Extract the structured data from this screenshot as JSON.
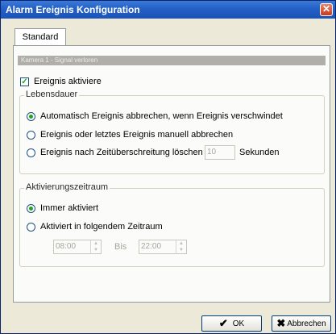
{
  "window": {
    "title": "Alarm Ereignis Konfiguration",
    "close_icon": "close-icon"
  },
  "tabs": [
    {
      "label": "Standard",
      "selected": true
    }
  ],
  "section_header": "Kamera 1 - Signal verloren",
  "enable_checkbox": {
    "label": "Ereignis aktiviere",
    "checked": true
  },
  "lifetime": {
    "title": "Lebensdauer",
    "options": [
      {
        "label": "Automatisch Ereignis abbrechen, wenn Ereignis verschwindet",
        "selected": true
      },
      {
        "label": "Ereignis oder letztes Ereignis manuell abbrechen",
        "selected": false
      },
      {
        "label": "Ereignis nach Zeitüberschreitung löschen",
        "selected": false
      }
    ],
    "timeout_value": "10",
    "timeout_unit": "Sekunden"
  },
  "activation": {
    "title": "Aktivierungszeitraum",
    "options": [
      {
        "label": "Immer aktiviert",
        "selected": true
      },
      {
        "label": "Aktiviert in folgendem Zeitraum",
        "selected": false
      }
    ],
    "from_time": "08:00",
    "to_label": "Bis",
    "to_time": "22:00"
  },
  "buttons": {
    "ok": "OK",
    "cancel": "Abbrechen"
  }
}
